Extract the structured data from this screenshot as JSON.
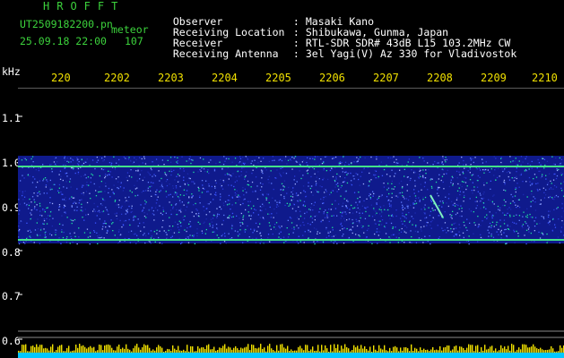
{
  "header": {
    "brand": "HROFFT",
    "filename": "UT2509182200.pn",
    "meteor_tag": "meteor",
    "datetime": "25.09.18 22:00",
    "count": "107"
  },
  "meta": [
    {
      "label": "Observer",
      "sep": ":",
      "value": "Masaki Kano"
    },
    {
      "label": "Receiving Location",
      "sep": ":",
      "value": "Shibukawa, Gunma, Japan"
    },
    {
      "label": "Receiver",
      "sep": ":",
      "value": "RTL-SDR SDR# 43dB L15 103.2MHz CW"
    },
    {
      "label": "Receiving Antenna",
      "sep": ":",
      "value": "3el Yagi(V) Az 330 for Vladivostok"
    }
  ],
  "axis": {
    "y_unit": "kHz",
    "x_ticks": [
      "220",
      "2202",
      "2203",
      "2204",
      "2205",
      "2206",
      "2207",
      "2208",
      "2209",
      "2210"
    ],
    "y_ticks": [
      "1.1",
      "1.0",
      "0.9",
      "0.8",
      "0.7",
      "0.6"
    ]
  },
  "colors": {
    "band": "#0f1a8c",
    "echo_line": "#43e08a",
    "meteor_trail": "#7ff0c0",
    "histogram_top": "#f0e000",
    "histogram_base": "#00c8ff"
  }
}
